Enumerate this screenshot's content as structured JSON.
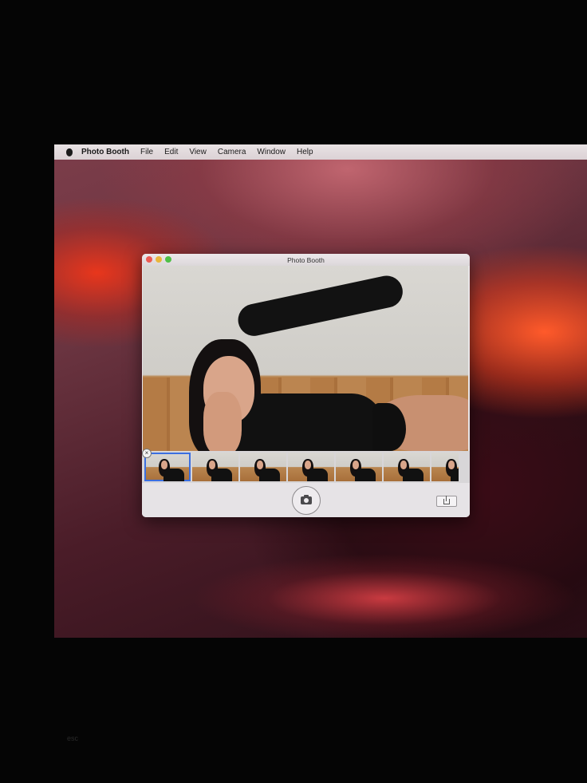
{
  "menubar": {
    "app_name": "Photo Booth",
    "items": [
      "File",
      "Edit",
      "View",
      "Camera",
      "Window",
      "Help"
    ]
  },
  "window": {
    "title": "Photo Booth"
  },
  "filmstrip": {
    "thumbnail_count": 7,
    "selected_index": 0
  },
  "toolbar": {
    "shutter_icon": "camera-icon",
    "share_icon": "share-icon"
  },
  "keyboard": {
    "esc_label": "esc"
  }
}
